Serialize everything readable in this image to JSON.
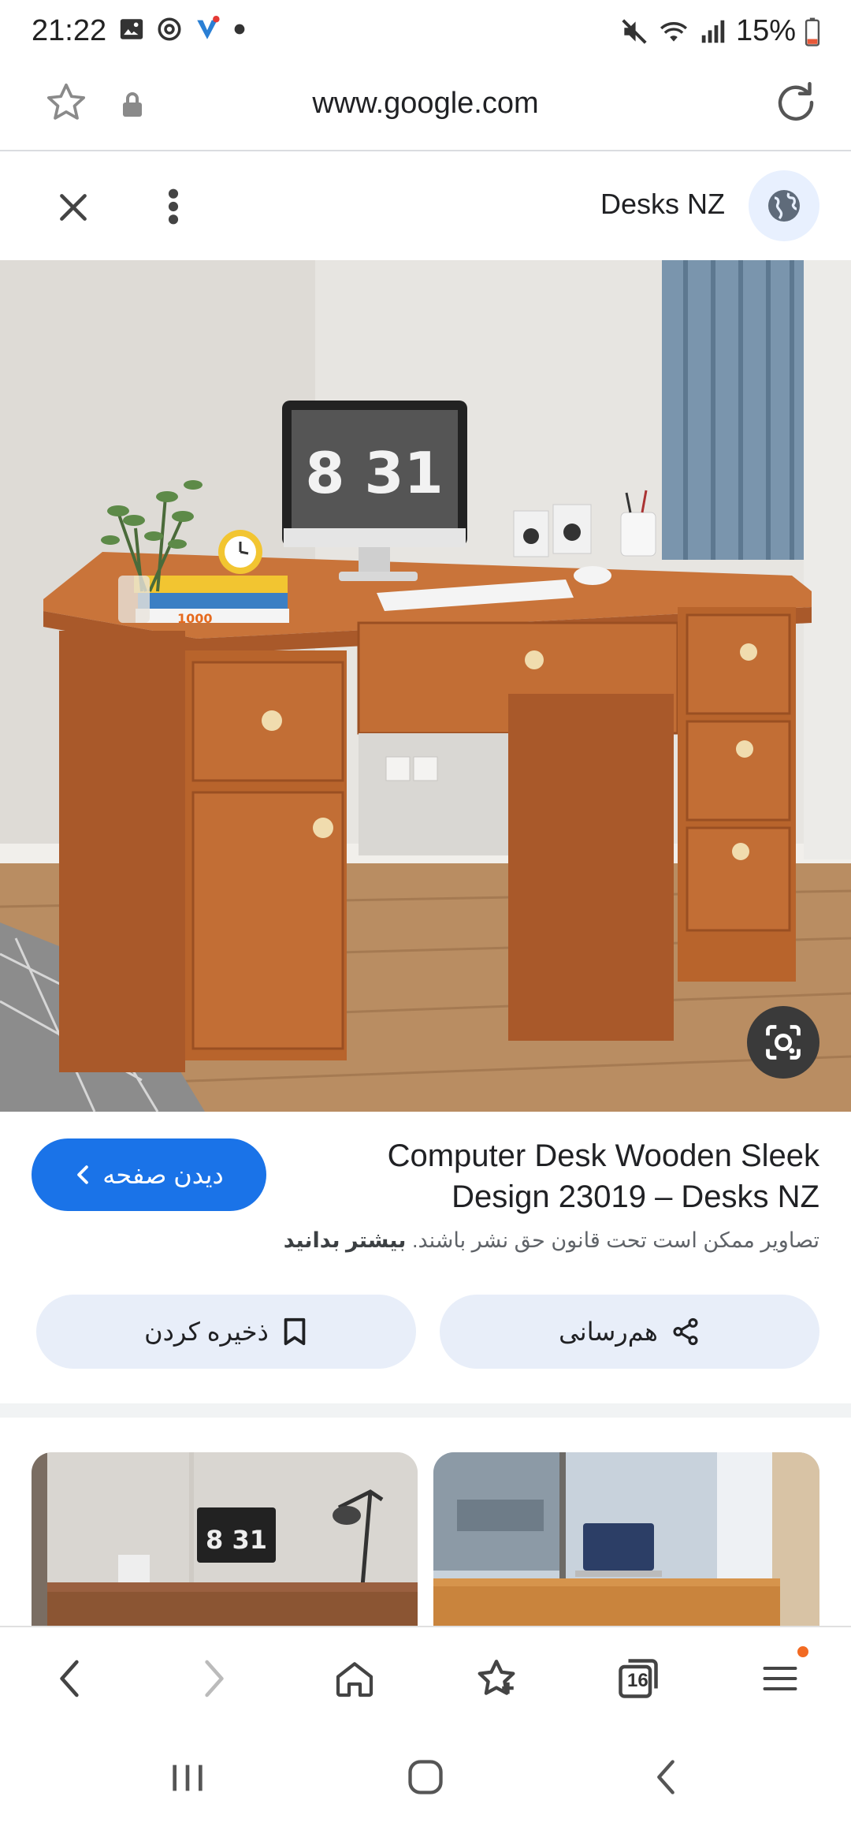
{
  "status_bar": {
    "time": "21:22",
    "battery": "15%",
    "icons": [
      "image-icon",
      "sync-icon",
      "vpn-icon",
      "dot-icon",
      "mute-icon",
      "wifi-icon",
      "signal-icon",
      "battery-icon"
    ]
  },
  "url_bar": {
    "url": "www.google.com",
    "icons": [
      "star-icon",
      "lock-icon",
      "reload-icon"
    ]
  },
  "lens_header": {
    "site_name": "Desks NZ",
    "icons": [
      "close-icon",
      "more-vert-icon",
      "globe-icon"
    ]
  },
  "result": {
    "title": "Computer Desk Wooden Sleek Design 23019 – Desks NZ",
    "visit_label": "دیدن صفحه",
    "copyright_text": "تصاویر ممکن است تحت قانون حق نشر باشند.",
    "learn_more": "بیشتر بدانید",
    "share_label": "هم‌رسانی",
    "save_label": "ذخیره کردن",
    "monitor_display": "8 31"
  },
  "bottom_nav": {
    "tab_count": "16",
    "icons": [
      "back-icon",
      "forward-icon",
      "home-icon",
      "bookmarks-icon",
      "tabs-icon",
      "menu-icon"
    ]
  },
  "colors": {
    "accent": "#1a73e8",
    "pill_bg": "#e8eef9",
    "desk": "#b8642c",
    "notification": "#f26a22"
  }
}
